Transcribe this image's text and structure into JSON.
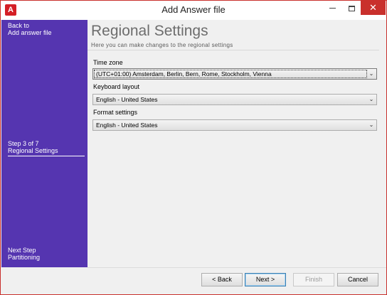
{
  "window": {
    "title": "Add Answer file",
    "app_icon_letter": "A",
    "close_glyph": "✕"
  },
  "sidebar": {
    "back_line1": "Back to",
    "back_line2": "Add answer file",
    "step_line1": "Step 3 of 7",
    "step_line2": "Regional Settings",
    "next_line1": "Next Step",
    "next_line2": "Partitioning",
    "background_color": "#5535b0"
  },
  "main": {
    "title": "Regional Settings",
    "subtitle": "Here you can make changes to the regional settings",
    "timezone": {
      "label": "Time zone",
      "value": "(UTC+01:00) Amsterdam, Berlin, Bern, Rome, Stockholm, Vienna"
    },
    "keyboard": {
      "label": "Keyboard layout",
      "value": "English - United States"
    },
    "format": {
      "label": "Format settings",
      "value": "English - United States"
    },
    "dropdown_arrow": "⌄"
  },
  "footer": {
    "back_label": "< Back",
    "next_label": "Next >",
    "finish_label": "Finish",
    "cancel_label": "Cancel",
    "finish_enabled": false
  },
  "colors": {
    "accent_red": "#c9302c",
    "sidebar_purple": "#5535b0"
  }
}
